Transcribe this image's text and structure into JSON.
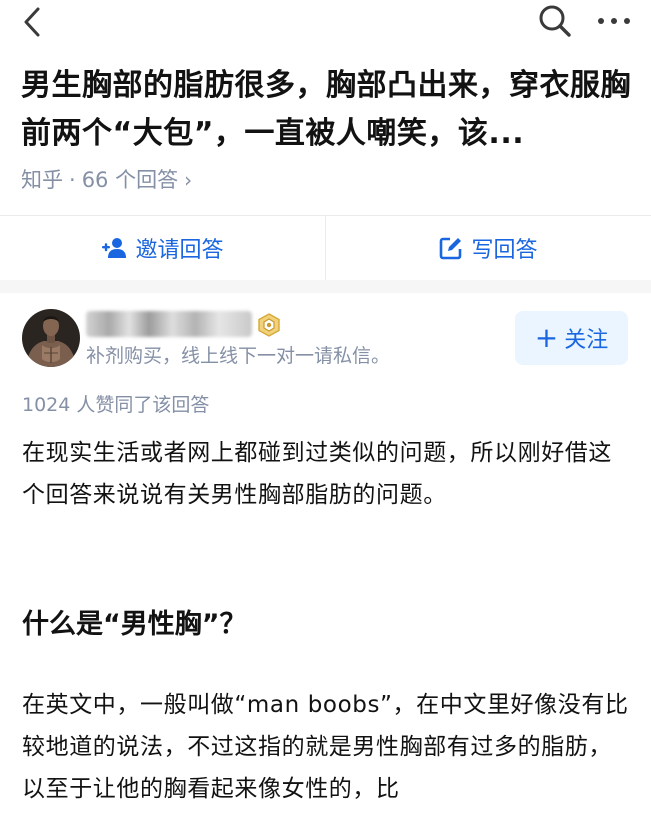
{
  "topbar": {
    "back_icon": "chevron-left-icon",
    "search_icon": "search-icon",
    "more_icon": "more-dots-icon"
  },
  "question": {
    "title": "男生胸部的脂肪很多，胸部凸出来，穿衣服胸前两个“大包”，一直被人嘲笑，该...",
    "source": "知乎",
    "separator": "·",
    "answer_count": "66 个回答",
    "chevron": "›"
  },
  "actions": {
    "invite_label": "邀请回答",
    "invite_icon": "add-user-icon",
    "write_label": "写回答",
    "write_icon": "edit-icon"
  },
  "author": {
    "bio": "补剂购买，线上线下一对一请私信。",
    "follow_label": "关注",
    "follow_plus": "+",
    "badge_icon": "certified-badge-icon"
  },
  "answer": {
    "vote_line": "1024 人赞同了该回答",
    "paragraph1": "在现实生活或者网上都碰到过类似的问题，所以刚好借这个回答来说说有关男性胸部脂肪的问题。",
    "heading": "什么是“男性胸”？",
    "paragraph2": "在英文中，一般叫做“man boobs”，在中文里好像没有比较地道的说法，不过这指的就是男性胸部有过多的脂肪，以至于让他的胸看起来像女性的，比"
  },
  "colors": {
    "accent": "#1a66e0",
    "meta": "#8590a6",
    "follow_bg": "#ebf5ff",
    "text": "#121212"
  }
}
